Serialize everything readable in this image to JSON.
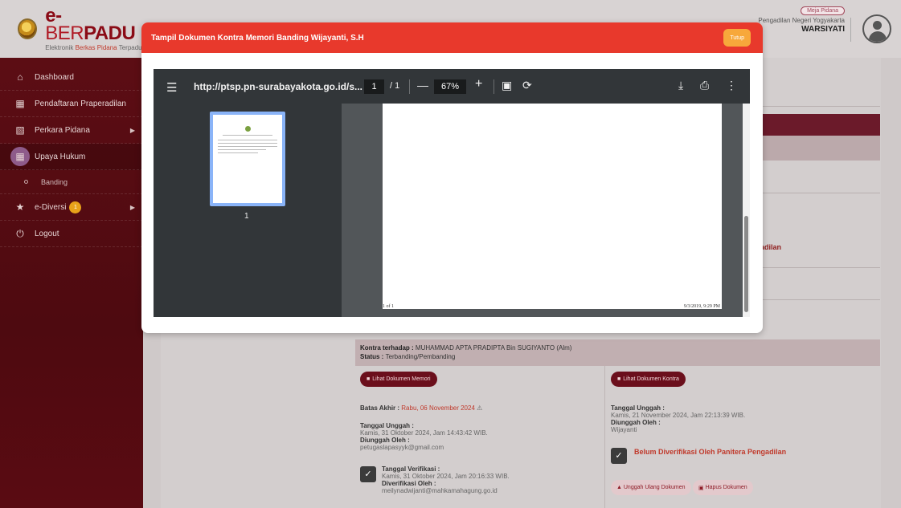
{
  "app": {
    "brand_name_e": "e-",
    "brand_name_ber": "BER",
    "brand_name_padu": "PADU",
    "brand_sub_1": "Elektronik ",
    "brand_sub_2": "Berkas Pidana",
    "brand_sub_3": " Terpadu"
  },
  "user": {
    "role": "Meja Pidana",
    "court": "Pengadilan Negeri Yogyakarta",
    "name": "WARSIYATI"
  },
  "sidebar": {
    "items": [
      {
        "label": "Dashboard",
        "icon": "home-icon"
      },
      {
        "label": "Pendaftaran Praperadilan",
        "icon": "file-icon"
      },
      {
        "label": "Perkara Pidana",
        "icon": "folder-icon"
      },
      {
        "label": "Upaya Hukum",
        "icon": "file-icon"
      },
      {
        "label": "Banding",
        "icon": "dot-icon"
      },
      {
        "label": "e-Diversi",
        "icon": "star-icon",
        "badge": "1"
      },
      {
        "label": "Logout",
        "icon": "power-icon"
      }
    ]
  },
  "modal": {
    "title": "Tampil Dokumen Kontra Memori Banding Wijayanti, S.H",
    "close_label": "Tutup"
  },
  "pdf": {
    "url": "http://ptsp.pn-surabayakota.go.id/s...",
    "page_current": "1",
    "page_total": "/  1",
    "zoom": "67%",
    "thumb_number": "1",
    "footer_left": "1 of 1",
    "footer_right": "9/3/2019, 9:29 PM"
  },
  "background": {
    "side_text": "adilan",
    "kontra_label": "Kontra terhadap : ",
    "kontra_value": "MUHAMMAD APTA PRADIPTA Bin SUGIYANTO (Alm)",
    "status_label": "Status : ",
    "status_value": "Terbanding/Pembanding",
    "left": {
      "button": "Lihat Dokumen Memori",
      "batas_label": "Batas Akhir : ",
      "batas_value": "Rabu, 06 November 2024",
      "tgl_unggah_label": "Tanggal Unggah :",
      "tgl_unggah_value": "Kamis, 31 Oktober 2024, Jam 14:43:42 WIB.",
      "diunggah_label": "Diunggah Oleh :",
      "diunggah_value": "petugaslapasyyk@gmail.com",
      "tgl_verif_label": "Tanggal Verifikasi :",
      "tgl_verif_value": "Kamis, 31 Oktober 2024, Jam 20:16:33 WIB.",
      "diverif_label": "Diverifikasi Oleh :",
      "diverif_value": "meilynadwijanti@mahkamahagung.go.id"
    },
    "right": {
      "button": "Lihat Dokumen Kontra",
      "tgl_unggah_label": "Tanggal Unggah :",
      "tgl_unggah_value": "Kamis, 21 November 2024, Jam 22:13:39 WIB.",
      "diunggah_label": "Diunggah Oleh :",
      "diunggah_value": "Wijayanti",
      "belum_label": "Belum Diverifikasi Oleh Panitera Pengadilan",
      "unggah_ulang": "Unggah Ulang Dokumen",
      "hapus": "Hapus Dokumen"
    }
  },
  "colors": {
    "modal_header": "#e8392c",
    "close_button": "#f7a83b",
    "sidebar": "#5c0d14",
    "doc_button": "#6b0f1c"
  }
}
